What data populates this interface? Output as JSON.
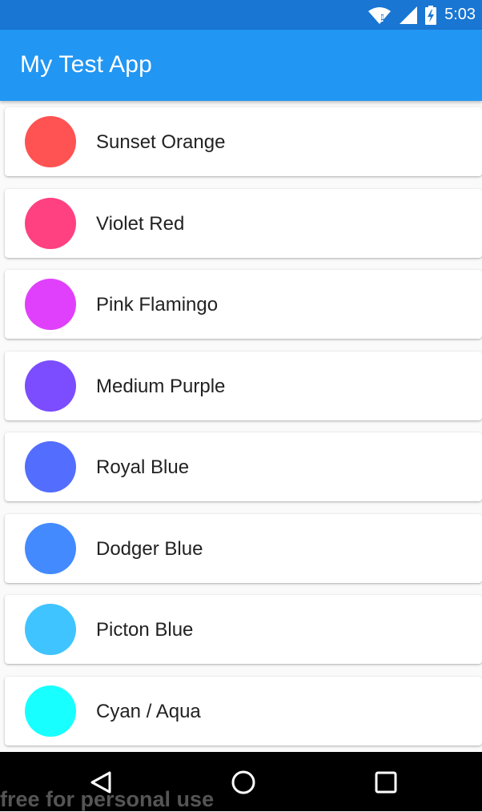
{
  "status_bar": {
    "time": "5:03",
    "icons": [
      "wifi-icon",
      "cell-signal-icon",
      "battery-charging-icon"
    ],
    "background": "#1976D2"
  },
  "app_bar": {
    "title": "My Test App",
    "background": "#2196F3"
  },
  "colors": [
    {
      "label": "Sunset Orange",
      "hex": "#FF5252"
    },
    {
      "label": "Violet Red",
      "hex": "#FF4081"
    },
    {
      "label": "Pink Flamingo",
      "hex": "#E040FB"
    },
    {
      "label": "Medium Purple",
      "hex": "#7C4DFF"
    },
    {
      "label": "Royal Blue",
      "hex": "#536DFE"
    },
    {
      "label": "Dodger Blue",
      "hex": "#448AFF"
    },
    {
      "label": "Picton Blue",
      "hex": "#40C4FF"
    },
    {
      "label": "Cyan / Aqua",
      "hex": "#18FFFF"
    }
  ],
  "nav_bar": {
    "icons": [
      "back-icon",
      "home-icon",
      "recents-icon"
    ]
  },
  "watermark": "free for personal use"
}
